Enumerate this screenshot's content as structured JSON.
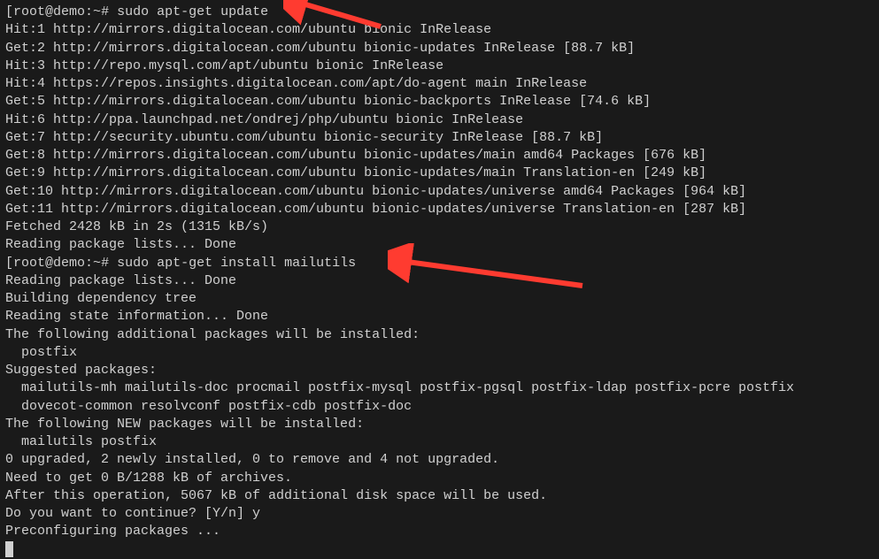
{
  "terminal": {
    "prompt1_open": "[",
    "prompt1_userhost": "root@demo",
    "prompt1_colon": ":",
    "prompt1_path": "~",
    "prompt1_close": "# ",
    "command1": "sudo apt-get update",
    "output_block1": [
      "Hit:1 http://mirrors.digitalocean.com/ubuntu bionic InRelease",
      "Get:2 http://mirrors.digitalocean.com/ubuntu bionic-updates InRelease [88.7 kB]",
      "Hit:3 http://repo.mysql.com/apt/ubuntu bionic InRelease",
      "Hit:4 https://repos.insights.digitalocean.com/apt/do-agent main InRelease",
      "Get:5 http://mirrors.digitalocean.com/ubuntu bionic-backports InRelease [74.6 kB]",
      "Hit:6 http://ppa.launchpad.net/ondrej/php/ubuntu bionic InRelease",
      "Get:7 http://security.ubuntu.com/ubuntu bionic-security InRelease [88.7 kB]",
      "Get:8 http://mirrors.digitalocean.com/ubuntu bionic-updates/main amd64 Packages [676 kB]",
      "Get:9 http://mirrors.digitalocean.com/ubuntu bionic-updates/main Translation-en [249 kB]",
      "Get:10 http://mirrors.digitalocean.com/ubuntu bionic-updates/universe amd64 Packages [964 kB]",
      "Get:11 http://mirrors.digitalocean.com/ubuntu bionic-updates/universe Translation-en [287 kB]",
      "Fetched 2428 kB in 2s (1315 kB/s)",
      "Reading package lists... Done"
    ],
    "prompt2_open": "[",
    "prompt2_userhost": "root@demo",
    "prompt2_colon": ":",
    "prompt2_path": "~",
    "prompt2_close": "# ",
    "command2": "sudo apt-get install mailutils",
    "output_block2": [
      "Reading package lists... Done",
      "Building dependency tree",
      "Reading state information... Done",
      "The following additional packages will be installed:",
      "  postfix",
      "Suggested packages:",
      "  mailutils-mh mailutils-doc procmail postfix-mysql postfix-pgsql postfix-ldap postfix-pcre postfix",
      "  dovecot-common resolvconf postfix-cdb postfix-doc",
      "The following NEW packages will be installed:",
      "  mailutils postfix",
      "0 upgraded, 2 newly installed, 0 to remove and 4 not upgraded.",
      "Need to get 0 B/1288 kB of archives.",
      "After this operation, 5067 kB of additional disk space will be used.",
      "Do you want to continue? [Y/n] y",
      "Preconfiguring packages ..."
    ]
  },
  "annotations": {
    "arrow_color": "#ff3b30"
  }
}
